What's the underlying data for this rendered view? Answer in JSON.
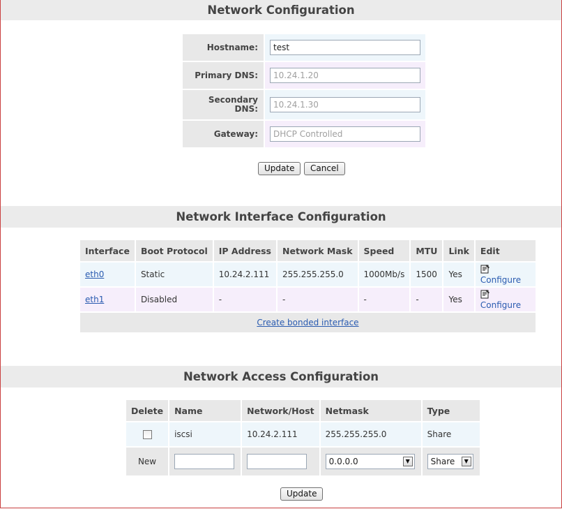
{
  "network": {
    "title": "Network Configuration",
    "fields": {
      "hostname": {
        "label": "Hostname:",
        "value": "test"
      },
      "primary_dns": {
        "label": "Primary DNS:",
        "placeholder": "10.24.1.20"
      },
      "secondary_dns": {
        "label": "Secondary DNS:",
        "placeholder": "10.24.1.30"
      },
      "gateway": {
        "label": "Gateway:",
        "placeholder": "DHCP Controlled"
      }
    },
    "update_label": "Update",
    "cancel_label": "Cancel"
  },
  "interfaces": {
    "title": "Network Interface Configuration",
    "headers": [
      "Interface",
      "Boot Protocol",
      "IP Address",
      "Network Mask",
      "Speed",
      "MTU",
      "Link",
      "Edit"
    ],
    "rows": [
      {
        "name": "eth0",
        "boot": "Static",
        "ip": "10.24.2.111",
        "mask": "255.255.255.0",
        "speed": "1000Mb/s",
        "mtu": "1500",
        "link": "Yes",
        "edit": "Configure"
      },
      {
        "name": "eth1",
        "boot": "Disabled",
        "ip": "-",
        "mask": "-",
        "speed": "-",
        "mtu": "-",
        "link": "Yes",
        "edit": "Configure"
      }
    ],
    "bonded_link": "Create bonded interface"
  },
  "access": {
    "title": "Network Access Configuration",
    "headers": [
      "Delete",
      "Name",
      "Network/Host",
      "Netmask",
      "Type"
    ],
    "rows": [
      {
        "name": "iscsi",
        "network": "10.24.2.111",
        "netmask": "255.255.255.0",
        "type": "Share"
      }
    ],
    "new_row": {
      "label": "New",
      "netmask_value": "0.0.0.0",
      "type_value": "Share"
    },
    "update_label": "Update"
  },
  "icons": {
    "configure": "configure-icon",
    "dropdown": "chevron-down-icon"
  }
}
